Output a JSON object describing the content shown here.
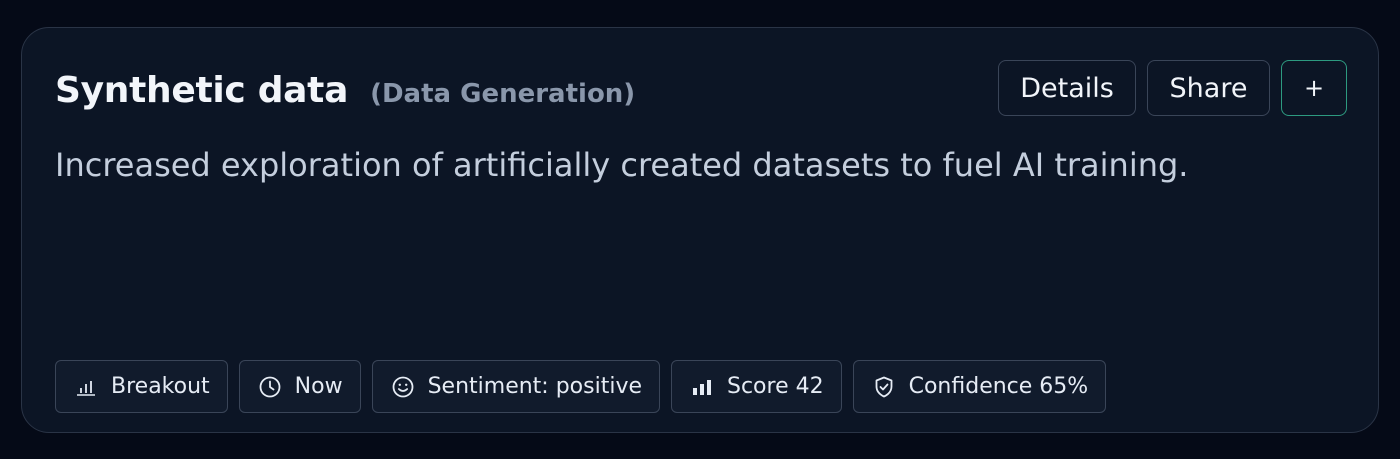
{
  "card": {
    "title": "Synthetic data",
    "category": "(Data Generation)",
    "description": "Increased exploration of artificially created datasets to fuel AI training."
  },
  "actions": {
    "details_label": "Details",
    "share_label": "Share",
    "add_label": "+"
  },
  "chips": [
    {
      "icon": "bar-chart-icon",
      "label": "Breakout"
    },
    {
      "icon": "clock-icon",
      "label": "Now"
    },
    {
      "icon": "smile-icon",
      "label": "Sentiment: positive"
    },
    {
      "icon": "signal-bars-icon",
      "label": "Score 42"
    },
    {
      "icon": "shield-check-icon",
      "label": "Confidence 65%"
    }
  ],
  "colors": {
    "background": "#050a17",
    "card": "#0c1525",
    "border": "#2a3446",
    "accent": "#2d9a80",
    "muted_text": "#8a97ab"
  }
}
